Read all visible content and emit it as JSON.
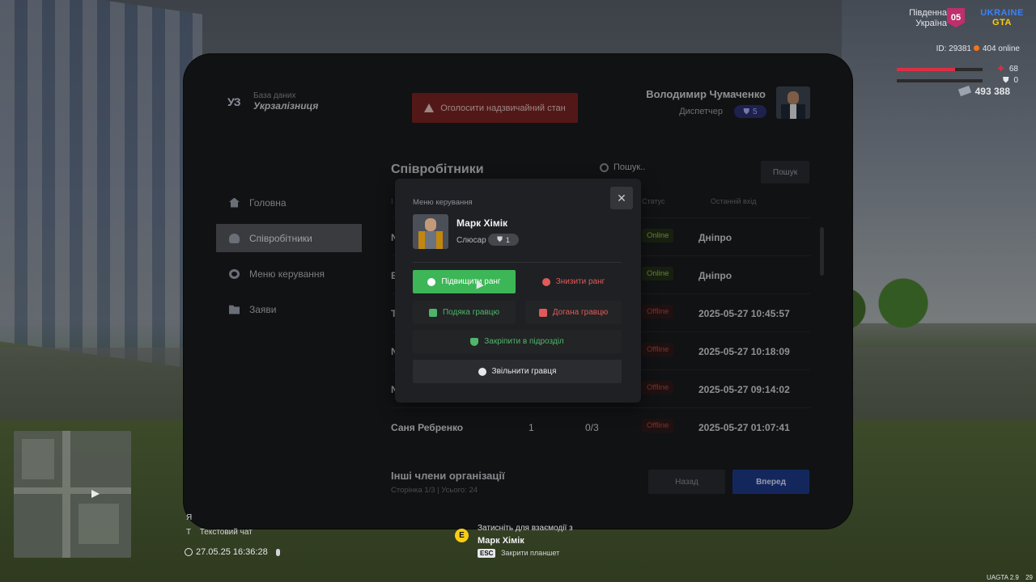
{
  "hud": {
    "region_line1": "Південна",
    "region_line2": "Україна",
    "region_badge": "05",
    "logo_line1": "UKRAINE",
    "logo_line2": "GTA",
    "player_id": "ID: 29381",
    "online": "404 online",
    "health": "68",
    "health_fraction": 0.68,
    "armor": "0",
    "money": "493 388",
    "version": "UAGTA 2.9",
    "version_suffix": "29"
  },
  "tablet": {
    "brand_mark": "УЗ",
    "brand_sub": "База даних",
    "brand_main": "Укрзалізниця",
    "alert_button": "Оголосити надзвичайний стан",
    "user": {
      "name": "Володимир Чумаченко",
      "role": "Диспетчер",
      "rank": "5"
    },
    "sidebar": [
      {
        "label": "Головна",
        "icon": "home-icon"
      },
      {
        "label": "Співробітники",
        "icon": "people-icon",
        "active": true
      },
      {
        "label": "Меню керування",
        "icon": "gear-icon"
      },
      {
        "label": "Заяви",
        "icon": "folder-icon"
      }
    ],
    "content": {
      "title": "Співробітники",
      "search_placeholder": "Пошук..",
      "search_button": "Пошук",
      "col_status": "Статус",
      "col_last_login": "Останній вхід",
      "col_first": "І"
    },
    "rows": [
      {
        "name": "N",
        "rank": "",
        "warns": "",
        "status": "Online",
        "last": "Дніпро"
      },
      {
        "name": "Е",
        "rank": "",
        "warns": "",
        "status": "Online",
        "last": "Дніпро"
      },
      {
        "name": "Т",
        "rank": "",
        "warns": "",
        "status": "Offline",
        "last": "2025-05-27 10:45:57"
      },
      {
        "name": "N",
        "rank": "",
        "warns": "",
        "status": "Offline",
        "last": "2025-05-27 10:18:09"
      },
      {
        "name": "N",
        "rank": "",
        "warns": "",
        "status": "Offline",
        "last": "2025-05-27 09:14:02"
      },
      {
        "name": "Саня Ребренко",
        "rank": "1",
        "warns": "0/3",
        "status": "Offline",
        "last": "2025-05-27 01:07:41"
      }
    ],
    "other_title": "Інші члени організації",
    "other_sub": "Сторінка 1/3 | Усього: 24",
    "btn_back": "Назад",
    "btn_next": "Вперед"
  },
  "modal": {
    "label": "Меню керування",
    "close": "✕",
    "name": "Марк Хімік",
    "role": "Слюсар",
    "rank": "1",
    "promote": "Підвищити ранг",
    "demote": "Знизити ранг",
    "thanks": "Подяка гравцю",
    "reprimand": "Догана гравцю",
    "assign": "Закріпити в підрозділ",
    "fire": "Звільнити гравця"
  },
  "bottom": {
    "chat_key": "T",
    "chat_hint": "Текстовий чат",
    "chat_prefix": "Я",
    "datetime": "27.05.25 16:36:28",
    "interact_key": "E",
    "interact_line1": "Затисніть для взаємодії з",
    "interact_name": "Марк Хімік",
    "esc_key": "ESC",
    "esc_hint": "Закрити планшет"
  }
}
